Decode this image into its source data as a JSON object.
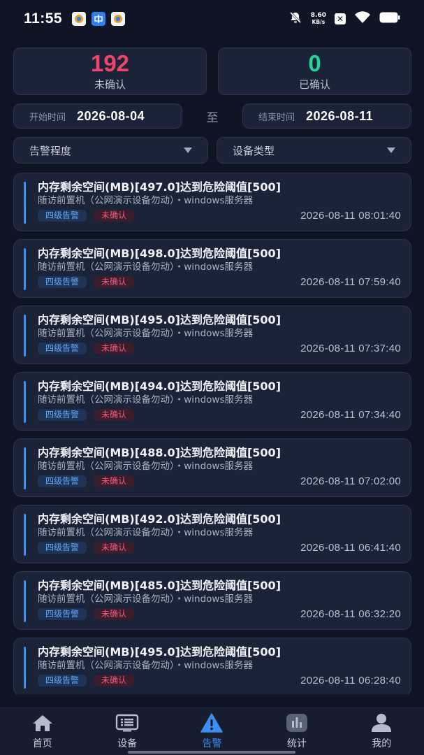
{
  "statusbar": {
    "time": "11:55",
    "speed_value": "8.60",
    "speed_unit": "KB/s",
    "app_icons": [
      "shield-app",
      "zhong-app",
      "browser-app"
    ]
  },
  "summary": {
    "unconfirmed": {
      "count": "192",
      "label": "未确认",
      "color": "#f0456b"
    },
    "confirmed": {
      "count": "0",
      "label": "已确认",
      "color": "#22d39a"
    }
  },
  "date_range": {
    "start_label": "开始时间",
    "start_value": "2026-08-04",
    "separator": "至",
    "end_label": "结束时间",
    "end_value": "2026-08-11"
  },
  "filters": {
    "severity": "告警程度",
    "device_type": "设备类型"
  },
  "alerts": [
    {
      "title": "内存剩余空间(MB)[497.0]达到危险阈值[500]",
      "source": "随访前置机（公网演示设备勿动）・windows服务器",
      "level": "四级告警",
      "status": "未确认",
      "time": "2026-08-11 08:01:40"
    },
    {
      "title": "内存剩余空间(MB)[498.0]达到危险阈值[500]",
      "source": "随访前置机（公网演示设备勿动）・windows服务器",
      "level": "四级告警",
      "status": "未确认",
      "time": "2026-08-11 07:59:40"
    },
    {
      "title": "内存剩余空间(MB)[495.0]达到危险阈值[500]",
      "source": "随访前置机（公网演示设备勿动）・windows服务器",
      "level": "四级告警",
      "status": "未确认",
      "time": "2026-08-11 07:37:40"
    },
    {
      "title": "内存剩余空间(MB)[494.0]达到危险阈值[500]",
      "source": "随访前置机（公网演示设备勿动）・windows服务器",
      "level": "四级告警",
      "status": "未确认",
      "time": "2026-08-11 07:34:40"
    },
    {
      "title": "内存剩余空间(MB)[488.0]达到危险阈值[500]",
      "source": "随访前置机（公网演示设备勿动）・windows服务器",
      "level": "四级告警",
      "status": "未确认",
      "time": "2026-08-11 07:02:00"
    },
    {
      "title": "内存剩余空间(MB)[492.0]达到危险阈值[500]",
      "source": "随访前置机（公网演示设备勿动）・windows服务器",
      "level": "四级告警",
      "status": "未确认",
      "time": "2026-08-11 06:41:40"
    },
    {
      "title": "内存剩余空间(MB)[485.0]达到危险阈值[500]",
      "source": "随访前置机（公网演示设备勿动）・windows服务器",
      "level": "四级告警",
      "status": "未确认",
      "time": "2026-08-11 06:32:20"
    },
    {
      "title": "内存剩余空间(MB)[495.0]达到危险阈值[500]",
      "source": "随访前置机（公网演示设备勿动）・windows服务器",
      "level": "四级告警",
      "status": "未确认",
      "time": "2026-08-11 06:28:40"
    }
  ],
  "nav": {
    "items": [
      {
        "label": "首页",
        "icon": "home-icon"
      },
      {
        "label": "设备",
        "icon": "device-icon"
      },
      {
        "label": "告警",
        "icon": "alert-icon",
        "active": true
      },
      {
        "label": "统计",
        "icon": "stats-icon"
      },
      {
        "label": "我的",
        "icon": "profile-icon"
      }
    ],
    "active_color": "#3d8ef0"
  }
}
